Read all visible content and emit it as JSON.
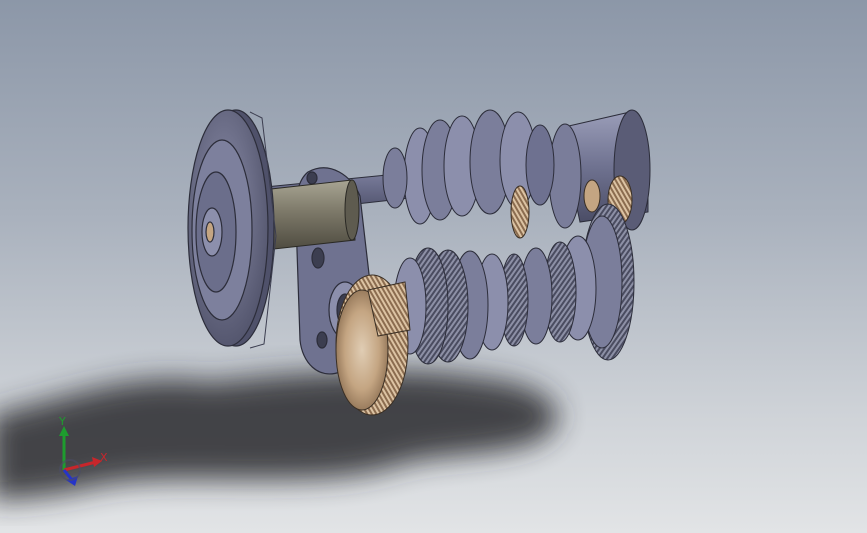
{
  "viewport": {
    "background_top": "#8c97a8",
    "background_bottom": "#e2e4e6"
  },
  "model": {
    "body_color": "#6f7290",
    "gear_bronze": "#c4a582",
    "shaft_color": "#7d7969"
  },
  "triad": {
    "x_label": "X",
    "y_label": "Y",
    "x_color": "#c8262b",
    "y_color": "#1e9c2e",
    "z_color": "#2634c8",
    "icons": [
      "x-axis-arrow-icon",
      "y-axis-arrow-icon",
      "z-axis-arrow-icon"
    ]
  }
}
